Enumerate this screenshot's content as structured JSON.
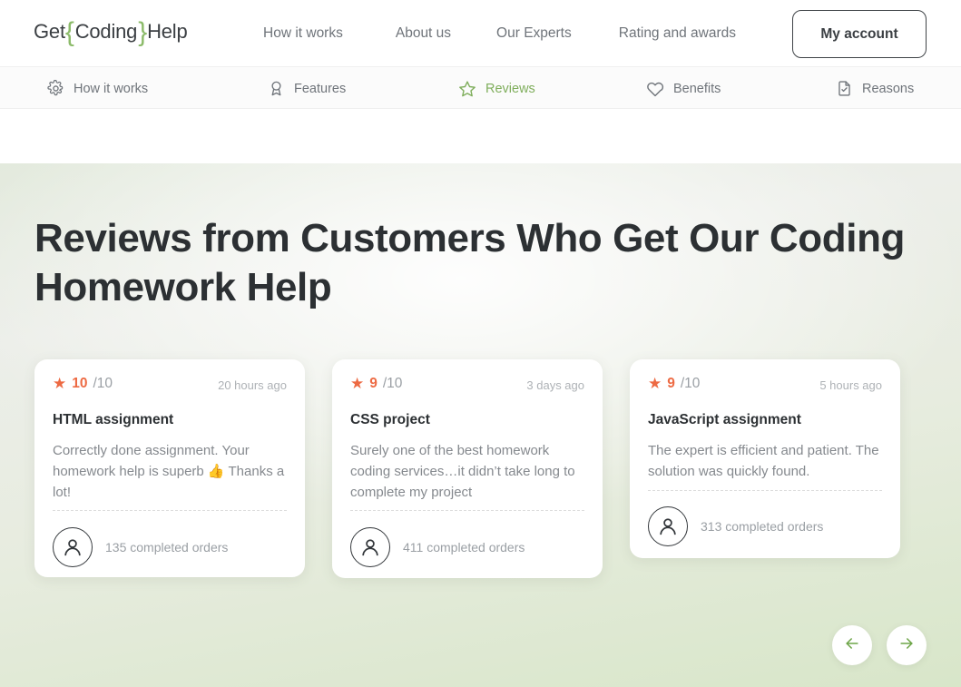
{
  "header": {
    "logo": {
      "prefix": "Get",
      "brace_open": "{",
      "middle": "Coding",
      "brace_close": "}",
      "suffix": "Help",
      "brace_color": "#8cbb6a"
    },
    "nav": [
      {
        "label": "How it works"
      },
      {
        "label": "About us"
      },
      {
        "label": "Our Experts"
      },
      {
        "label": "Rating and awards"
      }
    ],
    "account_button": "My account"
  },
  "subnav": {
    "active_color": "#7fae5c",
    "items": [
      {
        "label": "How it works",
        "icon": "gear-icon",
        "active": false
      },
      {
        "label": "Features",
        "icon": "award-ribbon-icon",
        "active": false
      },
      {
        "label": "Reviews",
        "icon": "star-outline-icon",
        "active": true
      },
      {
        "label": "Benefits",
        "icon": "heart-icon",
        "active": false
      },
      {
        "label": "Reasons",
        "icon": "document-check-icon",
        "active": false
      }
    ]
  },
  "hero": {
    "title": "Reviews from Customers Who Get Our Coding Homework Help",
    "accent_orange": "#ed6a43"
  },
  "reviews": [
    {
      "score": "10",
      "out_of": "/10",
      "time": "20 hours ago",
      "title": "HTML assignment",
      "text_before": "Correctly done assignment. Your homework help is superb ",
      "emoji": "👍",
      "text_after": " Thanks a lot!",
      "orders": "135 completed orders"
    },
    {
      "score": "9",
      "out_of": "/10",
      "time": "3 days ago",
      "title": "CSS project",
      "text_before": "Surely one of the best homework coding services…it didn’t take long to complete my project",
      "emoji": "",
      "text_after": "",
      "orders": "411 completed orders"
    },
    {
      "score": "9",
      "out_of": "/10",
      "time": "5 hours ago",
      "title": "JavaScript assignment",
      "text_before": "The expert is efficient and patient. The solution was quickly found.",
      "emoji": "",
      "text_after": "",
      "orders": "313 completed orders"
    }
  ],
  "carousel": {
    "prev_label": "←",
    "next_label": "→",
    "arrow_color": "#6da548"
  }
}
